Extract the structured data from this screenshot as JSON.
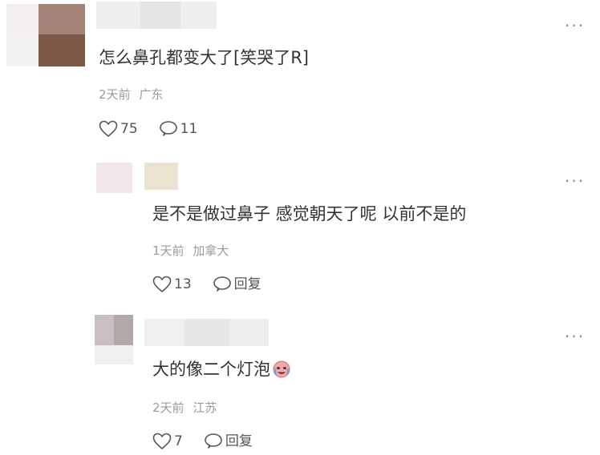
{
  "comments": [
    {
      "text": "怎么鼻孔都变大了[笑哭了R]",
      "date": "2天前",
      "location": "广东",
      "likes": "75",
      "replies": "11"
    },
    {
      "text": "是不是做过鼻子 感觉朝天了呢 以前不是的",
      "date": "1天前",
      "location": "加拿大",
      "likes": "13",
      "reply_label": "回复"
    },
    {
      "text": "大的像二个灯泡",
      "emoji_icon": "crying-face-emoji-icon",
      "date": "2天前",
      "location": "江苏",
      "likes": "7",
      "reply_label": "回复"
    }
  ],
  "more_symbol": "···",
  "icons": [
    "heart-icon",
    "comment-bubble-icon",
    "more-icon"
  ],
  "colors": {
    "text": "#333333",
    "meta": "#9a9a9a",
    "icon": "#555555"
  }
}
